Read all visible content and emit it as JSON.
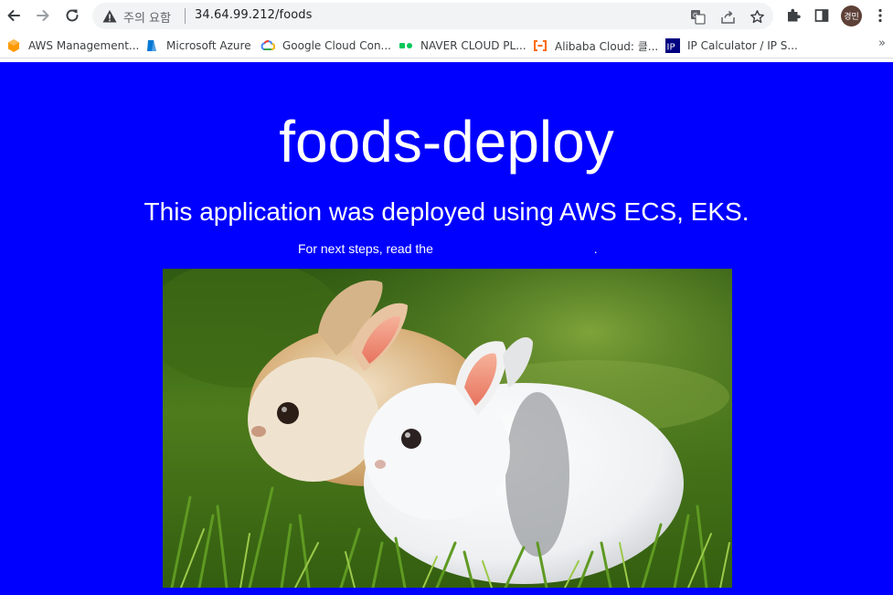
{
  "browser": {
    "omnibox": {
      "security_label": "주의 요함",
      "url": "34.64.99.212/foods"
    },
    "avatar_text": "경민",
    "bookmarks": [
      {
        "label": "AWS Management...",
        "icon": "aws-icon",
        "color": "#ff9900"
      },
      {
        "label": "Microsoft Azure",
        "icon": "azure-icon",
        "color": "#0078d4"
      },
      {
        "label": "Google Cloud Con...",
        "icon": "google-cloud-icon",
        "color": "#4285f4"
      },
      {
        "label": "NAVER CLOUD PL...",
        "icon": "naver-cloud-icon",
        "color": "#03c75a"
      },
      {
        "label": "Alibaba Cloud: 클...",
        "icon": "alibaba-cloud-icon",
        "color": "#ff6a00"
      },
      {
        "label": "IP Calculator / IP S...",
        "icon": "ip-calculator-icon",
        "color": "#000080"
      }
    ],
    "bookmarks_more": "»"
  },
  "page": {
    "background": "#0000ff",
    "title": "foods-deploy",
    "subtitle": "This application was deployed using AWS ECS, EKS.",
    "steps_prefix": "For next steps, read the",
    "steps_suffix": ".",
    "image_subject": "two-rabbits-in-grass-photo"
  }
}
